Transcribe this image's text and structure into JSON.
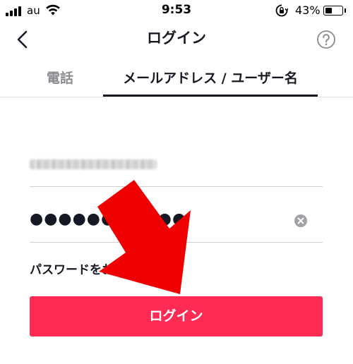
{
  "status_bar": {
    "carrier": "au",
    "time": "9:53",
    "battery_percent": "43%",
    "battery_level": 0.43,
    "icons": [
      "signal-icon",
      "wifi-icon",
      "rotation-lock-icon",
      "battery-icon"
    ]
  },
  "header": {
    "title": "ログイン",
    "back_icon": "chevron-left-icon",
    "help_icon": "question-circle-icon"
  },
  "tabs": [
    {
      "label": "電話",
      "selected": false
    },
    {
      "label": "メールアドレス / ユーザー名",
      "selected": true
    }
  ],
  "form": {
    "username_value_obscured": true,
    "password_value": "●●●●●●●●●●●",
    "forgot_password": "パスワードをお忘れですか？",
    "submit_label": "ログイン"
  },
  "colors": {
    "accent": "#fe2c55",
    "annotation_arrow": "#ee0000",
    "text_primary": "#161823",
    "text_secondary": "#8a8b91"
  }
}
